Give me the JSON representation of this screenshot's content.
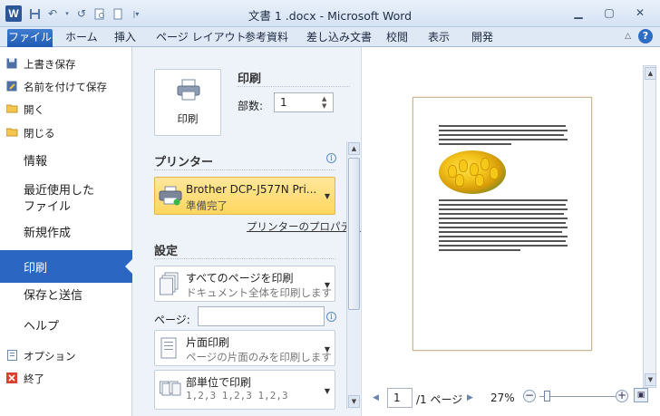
{
  "window": {
    "title": "文書 1 .docx - Microsoft Word",
    "app_icon_letter": "W"
  },
  "ribbon": {
    "tabs": [
      {
        "label": "ファイル"
      },
      {
        "label": "ホーム"
      },
      {
        "label": "挿入"
      },
      {
        "label": "ページ レイアウト"
      },
      {
        "label": "参考資料"
      },
      {
        "label": "差し込み文書"
      },
      {
        "label": "校閲"
      },
      {
        "label": "表示"
      },
      {
        "label": "開発"
      }
    ]
  },
  "backstage": {
    "small_items": [
      {
        "label": "上書き保存",
        "icon": "save-icon"
      },
      {
        "label": "名前を付けて保存",
        "icon": "save-as-icon"
      },
      {
        "label": "開く",
        "icon": "open-folder-icon"
      },
      {
        "label": "閉じる",
        "icon": "close-folder-icon"
      }
    ],
    "big_items": [
      {
        "label": "情報"
      },
      {
        "label": "最近使用した"
      },
      {
        "label": "ファイル"
      },
      {
        "label": "新規作成"
      },
      {
        "label": "印刷"
      },
      {
        "label": "保存と送信"
      },
      {
        "label": "ヘルプ"
      }
    ],
    "bottom_items": [
      {
        "label": "オプション",
        "icon": "options-icon"
      },
      {
        "label": "終了",
        "icon": "exit-icon"
      }
    ],
    "active_item": "印刷"
  },
  "print": {
    "section_title": "印刷",
    "print_button_label": "印刷",
    "copies_label": "部数:",
    "copies_value": "1",
    "printer_section_title": "プリンター",
    "printer_name": "Brother DCP-J577N Pri...",
    "printer_status": "準備完了",
    "printer_properties_link": "プリンターのプロパティ",
    "settings_title": "設定",
    "settings": [
      {
        "title": "すべてのページを印刷",
        "subtitle": "ドキュメント全体を印刷します"
      },
      {
        "title": "片面印刷",
        "subtitle": "ページの片面のみを印刷します"
      },
      {
        "title": "部単位で印刷",
        "subtitle": "1,2,3    1,2,3    1,2,3"
      }
    ],
    "pages_label": "ページ:",
    "pages_value": ""
  },
  "preview": {
    "current_page": "1",
    "total_pages": "/1 ページ",
    "zoom": "27%",
    "zoom_fraction": 0.27
  },
  "colors": {
    "accent": "#2b67c2",
    "printer_highlight": "#ffd65e"
  }
}
